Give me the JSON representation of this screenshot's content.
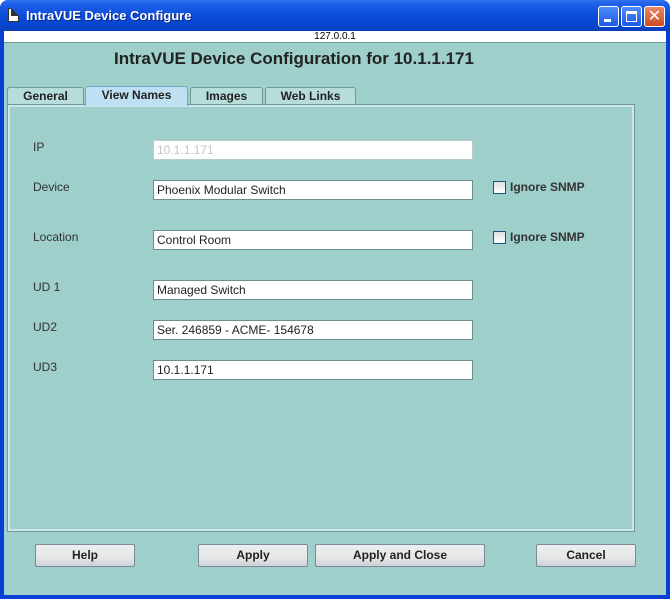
{
  "window": {
    "title": "IntraVUE Device Configure"
  },
  "host": "127.0.0.1",
  "heading": "IntraVUE Device Configuration for 10.1.1.171",
  "tabs": [
    {
      "label": "General"
    },
    {
      "label": "View Names",
      "selected": true
    },
    {
      "label": "Images"
    },
    {
      "label": "Web Links"
    }
  ],
  "form": {
    "ip": {
      "label": "IP",
      "value": "10.1.1.171",
      "disabled": true
    },
    "device": {
      "label": "Device",
      "value": "Phoenix Modular Switch",
      "ignore_snmp_label": "Ignore SNMP",
      "ignore_snmp_checked": false
    },
    "location": {
      "label": "Location",
      "value": "Control Room",
      "ignore_snmp_label": "Ignore SNMP",
      "ignore_snmp_checked": false
    },
    "ud1": {
      "label": "UD 1",
      "value": "Managed Switch"
    },
    "ud2": {
      "label": "UD2",
      "value": "Ser. 246859 - ACME- 154678"
    },
    "ud3": {
      "label": "UD3",
      "value": "10.1.1.171"
    }
  },
  "buttons": {
    "help": "Help",
    "apply": "Apply",
    "apply_close": "Apply and Close",
    "cancel": "Cancel"
  },
  "colors": {
    "titlebar": "#0a4bd8",
    "client_bg": "#9ecfcb",
    "active_tab": "#bfe0f2"
  },
  "icons": {
    "window": "document-icon",
    "minimize": "minimize-icon",
    "maximize": "maximize-icon",
    "close": "close-icon"
  }
}
